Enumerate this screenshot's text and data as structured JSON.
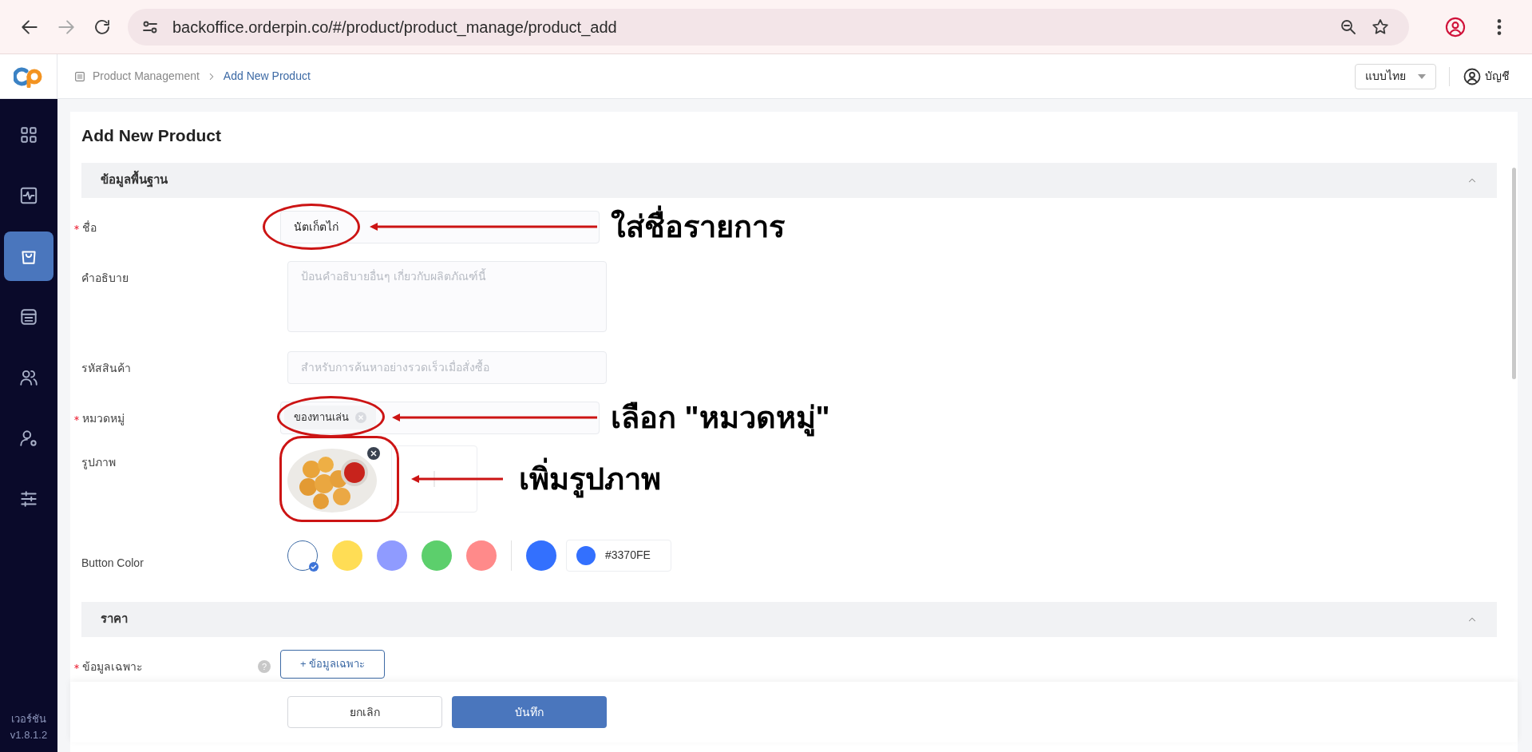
{
  "browser": {
    "url": "backoffice.orderpin.co/#/product/product_manage/product_add"
  },
  "header": {
    "breadcrumb": [
      {
        "label": "Product Management",
        "current": false
      },
      {
        "label": "Add New Product",
        "current": true
      }
    ],
    "language": "แบบไทย",
    "account": "บัญชี"
  },
  "sidebar": {
    "items": [
      {
        "kind": "grid",
        "selected": false
      },
      {
        "kind": "activity",
        "selected": false
      },
      {
        "kind": "bag",
        "selected": true
      },
      {
        "kind": "archive",
        "selected": false
      },
      {
        "kind": "users",
        "selected": false
      },
      {
        "kind": "user-gear",
        "selected": false
      },
      {
        "kind": "sliders",
        "selected": false
      }
    ],
    "version_label": "เวอร์ชัน",
    "version": "v1.8.1.2"
  },
  "title": "Add New Product",
  "sections": [
    {
      "title": "ข้อมูลพื้นฐาน",
      "expanded": true,
      "fields": [
        {
          "kind": "text",
          "label": "ชื่อ",
          "required": true,
          "value": "นัตเก็ตไก่",
          "annotation": "ใส่ชื่อรายการ"
        },
        {
          "kind": "textarea",
          "label": "คำอธิบาย",
          "required": false,
          "placeholder": "ป้อนคำอธิบายอื่นๆ เกี่ยวกับผลิตภัณฑ์นี้"
        },
        {
          "kind": "text",
          "label": "รหัสสินค้า",
          "required": false,
          "placeholder": "สำหรับการค้นหาอย่างรวดเร็วเมื่อสั่งซื้อ"
        },
        {
          "kind": "tags",
          "label": "หมวดหมู่",
          "required": true,
          "tags": [
            "ของทานเล่น"
          ],
          "annotation": "เลือก \"หมวดหมู่\""
        },
        {
          "kind": "images",
          "label": "รูปภาพ",
          "required": false,
          "annotation": "เพิ่มรูปภาพ"
        },
        {
          "kind": "colors",
          "label": "Button Color",
          "required": false,
          "swatches": [
            {
              "color": "#ffffff",
              "selected": true
            },
            {
              "color": "#ffdd55",
              "selected": false
            },
            {
              "color": "#8f9bff",
              "selected": false
            },
            {
              "color": "#5ccf6c",
              "selected": false
            },
            {
              "color": "#ff8a8a",
              "selected": false
            }
          ],
          "custom": {
            "color": "#3370fe",
            "hex": "#3370FE"
          }
        }
      ]
    },
    {
      "title": "ราคา",
      "expanded": true,
      "fields": [
        {
          "kind": "button",
          "label": "ข้อมูลเฉพาะ",
          "required": true,
          "help": "?",
          "button": "+ ข้อมูลเฉพาะ"
        }
      ]
    }
  ],
  "footer": {
    "cancel": "ยกเลิก",
    "save": "บันทึก"
  }
}
